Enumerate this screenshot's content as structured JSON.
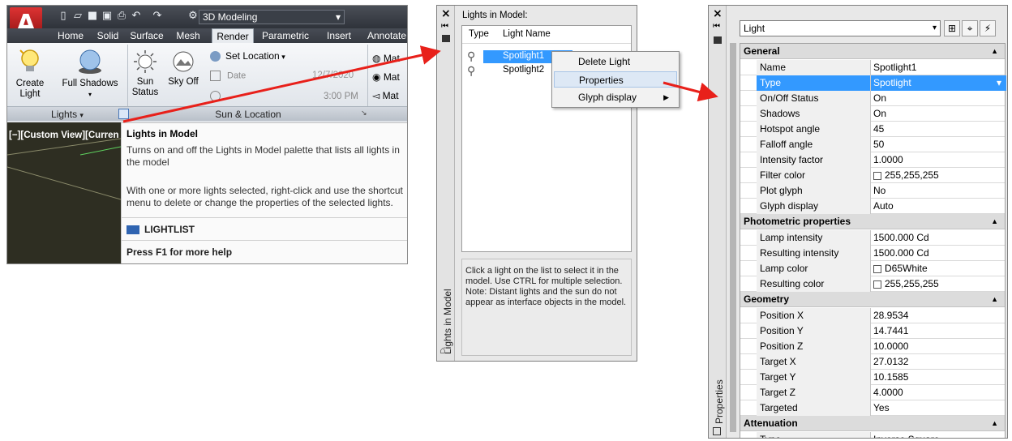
{
  "ribbon": {
    "workspace": "3D Modeling",
    "tabs": [
      "Home",
      "Solid",
      "Surface",
      "Mesh",
      "Render",
      "Parametric",
      "Insert",
      "Annotate"
    ],
    "active_tab": "Render",
    "lights_panel": {
      "create_light": "Create\nLight",
      "full_shadows": "Full Shadows",
      "title": "Lights"
    },
    "sun_panel": {
      "sun_status": "Sun\nStatus",
      "sky_off": "Sky Off",
      "set_location": "Set Location",
      "date_label": "Date",
      "date_value": "12/7/2020",
      "time_value": "3:00 PM",
      "title": "Sun & Location"
    },
    "materials_panel": {
      "items": [
        "Mat",
        "Mat",
        "Mat"
      ]
    }
  },
  "viewport": {
    "label": "[−][Custom View][Curren"
  },
  "tooltip": {
    "title": "Lights in Model",
    "line1": "Turns on and off the Lights in Model palette that lists all lights in the model",
    "line2": "With one or more lights selected, right-click and use the shortcut menu to delete or change the properties of the selected lights.",
    "command": "LIGHTLIST",
    "help": "Press F1 for more help"
  },
  "lights_palette": {
    "title": "Lights in Model:",
    "vertical_title": "Lights in Model",
    "columns": [
      "Type",
      "Light Name"
    ],
    "lights": [
      "Spotlight1",
      "Spotlight2"
    ],
    "help_text": "Click a light on the list to select it in the model. Use CTRL for multiple selection. Note: Distant lights and the sun do not appear as interface objects in the model."
  },
  "context_menu": {
    "items": [
      "Delete Light",
      "Properties",
      "Glyph display"
    ]
  },
  "properties": {
    "vertical_title": "Properties",
    "object_type": "Light",
    "sections": [
      {
        "title": "General",
        "rows": [
          {
            "key": "Name",
            "value": "Spotlight1"
          },
          {
            "key": "Type",
            "value": "Spotlight"
          },
          {
            "key": "On/Off Status",
            "value": "On"
          },
          {
            "key": "Shadows",
            "value": "On"
          },
          {
            "key": "Hotspot angle",
            "value": "45"
          },
          {
            "key": "Falloff angle",
            "value": "50"
          },
          {
            "key": "Intensity factor",
            "value": "1.0000"
          },
          {
            "key": "Filter color",
            "value": "255,255,255"
          },
          {
            "key": "Plot glyph",
            "value": "No"
          },
          {
            "key": "Glyph display",
            "value": "Auto"
          }
        ]
      },
      {
        "title": "Photometric properties",
        "rows": [
          {
            "key": "Lamp intensity",
            "value": "1500.000 Cd"
          },
          {
            "key": "Resulting intensity",
            "value": "1500.000 Cd"
          },
          {
            "key": "Lamp color",
            "value": "D65White"
          },
          {
            "key": "Resulting color",
            "value": "255,255,255"
          }
        ]
      },
      {
        "title": "Geometry",
        "rows": [
          {
            "key": "Position X",
            "value": "28.9534"
          },
          {
            "key": "Position Y",
            "value": "14.7441"
          },
          {
            "key": "Position Z",
            "value": "10.0000"
          },
          {
            "key": "Target X",
            "value": "27.0132"
          },
          {
            "key": "Target Y",
            "value": "10.1585"
          },
          {
            "key": "Target Z",
            "value": "4.0000"
          },
          {
            "key": "Targeted",
            "value": "Yes"
          }
        ]
      },
      {
        "title": "Attenuation",
        "rows": [
          {
            "key": "Type",
            "value": "Inverse Square"
          }
        ]
      }
    ]
  },
  "colors": {
    "selection": "#3399ff",
    "arrow": "#e8201a",
    "logo": "#c4161c"
  }
}
